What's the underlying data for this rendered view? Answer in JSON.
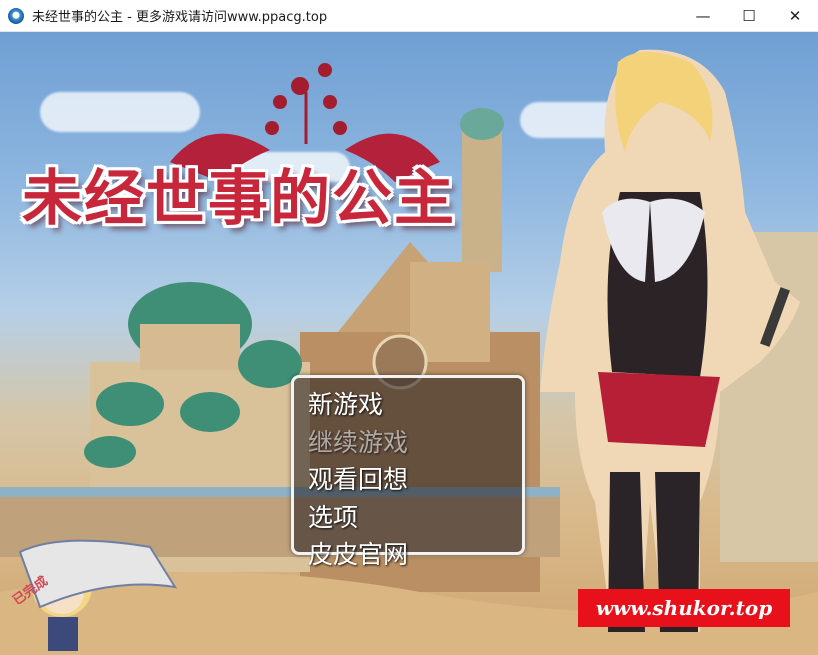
{
  "window": {
    "title": "未经世事的公主 - 更多游戏请访问www.ppacg.top",
    "minimize_glyph": "—",
    "maximize_glyph": "☐",
    "close_glyph": "✕"
  },
  "game": {
    "logo_title": "未经世事的公主",
    "menu": [
      {
        "label": "新游戏",
        "enabled": true
      },
      {
        "label": "继续游戏",
        "enabled": false
      },
      {
        "label": "观看回想",
        "enabled": true
      },
      {
        "label": "选项",
        "enabled": true
      },
      {
        "label": "皮皮官网",
        "enabled": true
      }
    ],
    "watermark": "www.shukor.top",
    "chibi_banner_text": "已完成"
  },
  "colors": {
    "logo_red": "#c8263b",
    "watermark_red": "#e8101a",
    "menu_bg": "rgba(40,32,34,0.58)"
  }
}
